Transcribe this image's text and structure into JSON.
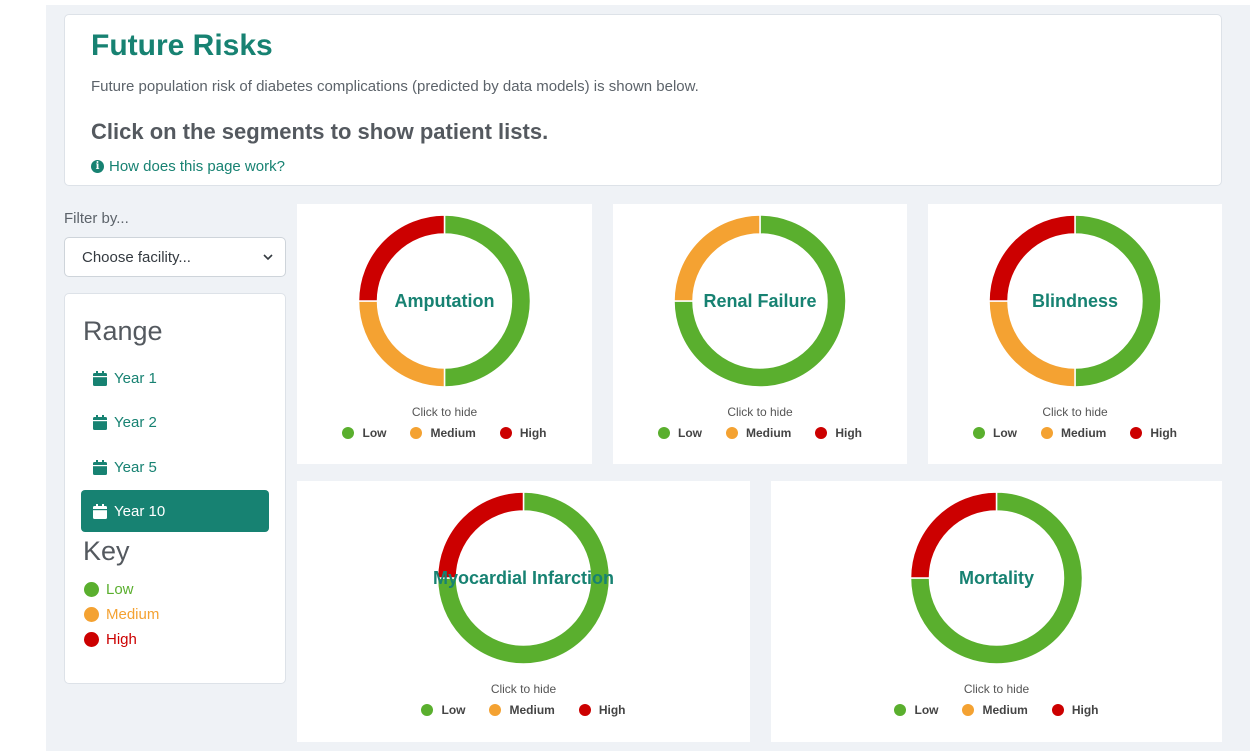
{
  "header": {
    "title": "Future Risks",
    "description": "Future population risk of diabetes complications (predicted by data models) is shown below.",
    "instruction": "Click on the segments to show patient lists.",
    "help_link": "How does this page work?"
  },
  "filter": {
    "label": "Filter by...",
    "facility_select": "Choose facility..."
  },
  "range": {
    "title": "Range",
    "items": [
      {
        "label": "Year 1",
        "active": false
      },
      {
        "label": "Year 2",
        "active": false
      },
      {
        "label": "Year 5",
        "active": false
      },
      {
        "label": "Year 10",
        "active": true
      }
    ]
  },
  "key": {
    "title": "Key",
    "items": [
      {
        "label": "Low",
        "color": "#5aaf2e"
      },
      {
        "label": "Medium",
        "color": "#f4a232"
      },
      {
        "label": "High",
        "color": "#cc0000"
      }
    ]
  },
  "colors": {
    "accent": "#178272",
    "low": "#5aaf2e",
    "medium": "#f4a232",
    "high": "#cc0000"
  },
  "chart_common": {
    "click_to_hide": "Click to hide",
    "legend": [
      "Low",
      "Medium",
      "High"
    ]
  },
  "chart_data": [
    {
      "type": "pie",
      "title": "Amputation",
      "categories": [
        "Low",
        "Medium",
        "High"
      ],
      "values": [
        50,
        25,
        25
      ]
    },
    {
      "type": "pie",
      "title": "Renal Failure",
      "categories": [
        "Low",
        "Medium",
        "High"
      ],
      "values": [
        75,
        25,
        0
      ]
    },
    {
      "type": "pie",
      "title": "Blindness",
      "categories": [
        "Low",
        "Medium",
        "High"
      ],
      "values": [
        50,
        25,
        25
      ]
    },
    {
      "type": "pie",
      "title": "Myocardial Infarction",
      "categories": [
        "Low",
        "Medium",
        "High"
      ],
      "values": [
        75,
        0,
        25
      ]
    },
    {
      "type": "pie",
      "title": "Mortality",
      "categories": [
        "Low",
        "Medium",
        "High"
      ],
      "values": [
        75,
        0,
        25
      ]
    }
  ]
}
